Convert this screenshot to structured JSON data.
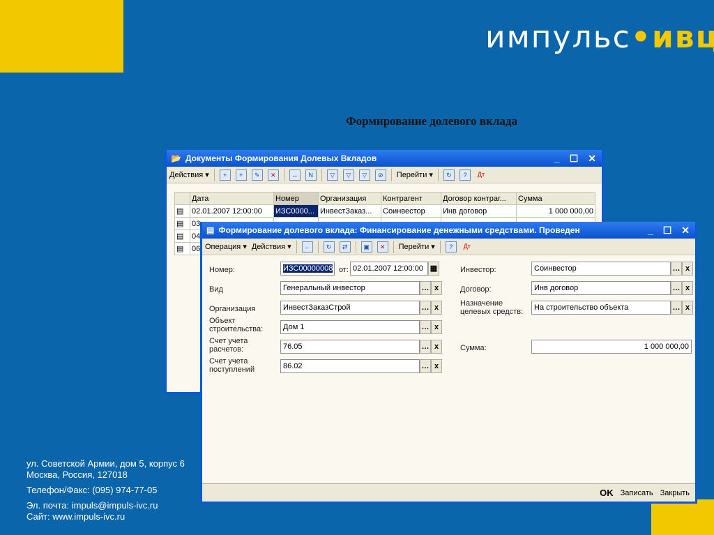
{
  "logo": {
    "text": "импульс",
    "dot": "•",
    "accent": "ивц"
  },
  "slide_title": "Формирование долевого вклада",
  "contacts": [
    "ул. Советской Армии, дом 5, корпус 6",
    "Москва, Россия, 127018",
    "Телефон/Факс: (095) 974-77-05",
    "Эл. почта: impuls@impuls-ivc.ru",
    "Сайт: www.impuls-ivc.ru"
  ],
  "colors": {
    "background": "#0b65ab",
    "accent": "#f2c900",
    "titlebar": "#0a52d0"
  },
  "list_window": {
    "title": "Документы Формирования Долевых Вкладов",
    "toolbar": {
      "actions": "Действия ▾",
      "goto": "Перейти ▾"
    },
    "columns": [
      "Дата",
      "Номер",
      "Организация",
      "Контрагент",
      "Договор контраг...",
      "Сумма"
    ],
    "rows": [
      [
        "02.01.2007 12:00:00",
        "ИЗС0000...",
        "ИнвестЗаказ...",
        "Соинвестор",
        "Инв договор",
        "1 000 000,00"
      ],
      [
        "03",
        "",
        "",
        "",
        "",
        ""
      ],
      [
        "04",
        "",
        "",
        "",
        "",
        ""
      ],
      [
        "06",
        "",
        "",
        "",
        "",
        ""
      ]
    ]
  },
  "form_window": {
    "title": "Формирование долевого вклада: Финансирование денежными средствами. Проведен",
    "toolbar": {
      "operation": "Операция ▾",
      "actions": "Действия ▾",
      "goto": "Перейти ▾"
    },
    "fields": {
      "number": {
        "label": "Номер:",
        "value": "ИЗС00000008"
      },
      "date": {
        "label": "от:",
        "value": "02.01.2007 12:00:00"
      },
      "kind": {
        "label": "Вид",
        "value": "Генеральный инвестор"
      },
      "org": {
        "label": "Организация",
        "value": "ИнвестЗаказСтрой"
      },
      "object": {
        "label": "Объект строительства:",
        "value": "Дом 1"
      },
      "account_settle": {
        "label": "Счет учета расчетов:",
        "value": "76.05"
      },
      "account_recv": {
        "label": "Счет учета поступлений",
        "value": "86.02"
      },
      "investor": {
        "label": "Инвестор:",
        "value": "Соинвестор"
      },
      "contract": {
        "label": "Договор:",
        "value": "Инв договор"
      },
      "purpose": {
        "label": "Назначение целевых средств:",
        "value": "На строительство объекта"
      },
      "sum": {
        "label": "Сумма:",
        "value": "1 000 000,00"
      }
    },
    "buttons": {
      "ok": "OK",
      "save": "Записать",
      "close": "Закрыть"
    }
  }
}
